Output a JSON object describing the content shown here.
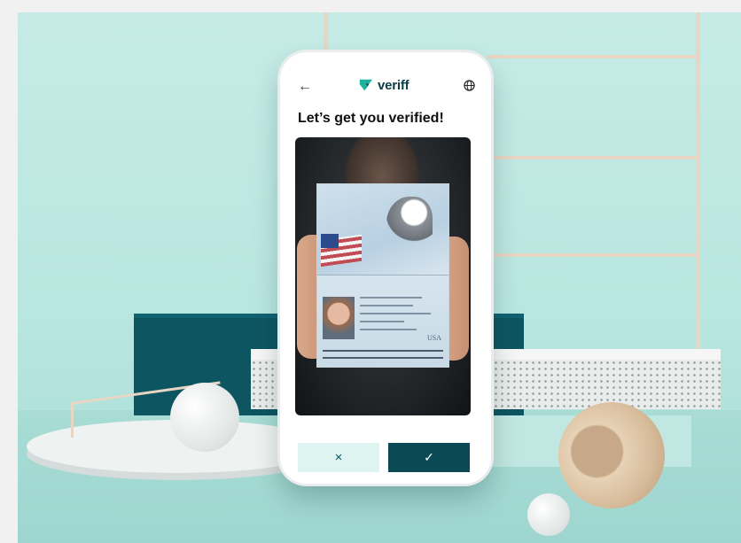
{
  "app": {
    "brand": "veriff"
  },
  "screen": {
    "title": "Let’s get you verified!"
  },
  "icons": {
    "back": "arrow-left-icon",
    "language": "globe-icon",
    "logo": "veriff-logo-mark"
  },
  "actions": {
    "retake_label": "×",
    "confirm_label": "✓"
  },
  "passport": {
    "country_mark": "USA"
  },
  "colors": {
    "brand_dark": "#0b4a55",
    "brand_light": "#def4f0",
    "accent": "#1bb39b"
  }
}
